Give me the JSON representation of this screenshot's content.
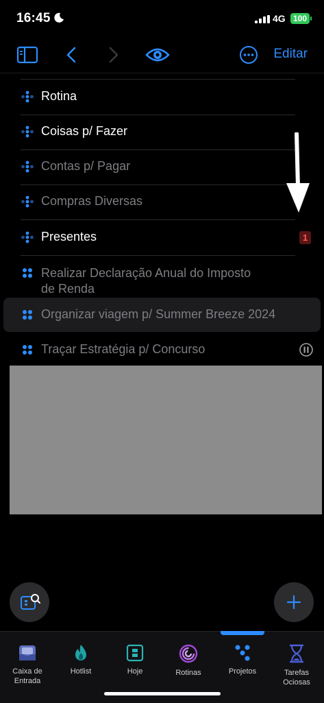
{
  "status": {
    "time": "16:45",
    "network": "4G",
    "battery": "100"
  },
  "toolbar": {
    "edit_label": "Editar"
  },
  "list": {
    "items": [
      {
        "label": "Rotina"
      },
      {
        "label": "Coisas p/ Fazer"
      },
      {
        "label": "Contas p/ Pagar"
      },
      {
        "label": "Compras Diversas"
      },
      {
        "label": "Presentes",
        "badge": "1"
      },
      {
        "label_line1": "Realizar Declaração Anual do Imposto",
        "label_line2": "de Renda"
      },
      {
        "label": "Organizar viagem p/ Summer Breeze 2024"
      },
      {
        "label": "Traçar Estratégia p/ Concurso"
      }
    ]
  },
  "tabs": [
    {
      "label_line1": "Caixa de",
      "label_line2": "Entrada",
      "icon": "inbox-icon"
    },
    {
      "label": "Hotlist",
      "icon": "flame-icon"
    },
    {
      "label": "Hoje",
      "icon": "today-icon"
    },
    {
      "label": "Rotinas",
      "icon": "routine-icon"
    },
    {
      "label": "Projetos",
      "icon": "projects-icon"
    },
    {
      "label_line1": "Tarefas",
      "label_line2": "Ociosas",
      "icon": "hourglass-icon"
    }
  ],
  "colors": {
    "accent": "#2d8cff",
    "badge_bg": "#5a1414",
    "badge_text": "#ff5d5d",
    "battery": "#31c759"
  }
}
